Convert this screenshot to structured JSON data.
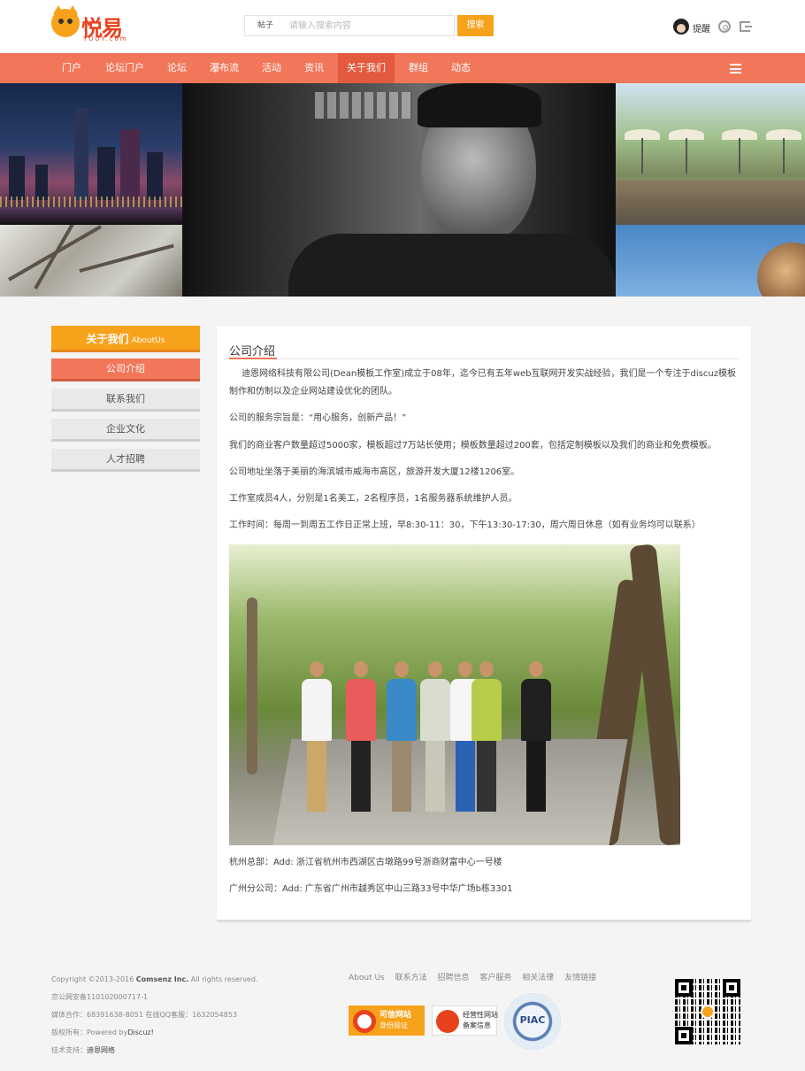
{
  "header": {
    "logo_text": "悦易",
    "logo_sub": "YUUY.com",
    "search_type": "帖子",
    "search_placeholder": "请输入搜索内容",
    "search_button": "搜索",
    "user_remind": "提醒"
  },
  "nav": {
    "items": [
      "门户",
      "论坛门户",
      "论坛",
      "瀑布流",
      "活动",
      "资讯",
      "关于我们",
      "群组",
      "动态"
    ],
    "active": "关于我们"
  },
  "sidebar": {
    "title": "关于我们",
    "title_en": "AboutUs",
    "items": [
      "公司介绍",
      "联系我们",
      "企业文化",
      "人才招聘"
    ],
    "active": "公司介绍"
  },
  "content": {
    "title": "公司介绍",
    "paragraphs": [
      "迪恩网络科技有限公司(Dean模板工作室)成立于08年，迄今已有五年web互联网开发实战经验，我们是一个专注于discuz模板制作和仿制以及企业网站建设优化的团队。",
      "公司的服务宗旨是：“用心服务，创新产品！”",
      "我们的商业客户数量超过5000家，模板超过7万站长使用；模板数量超过200套，包括定制模板以及我们的商业和免费模板。",
      "公司地址坐落于美丽的海滨城市威海市高区，旅游开发大厦12楼1206室。",
      "工作室成员4人，分别是1名美工，2名程序员，1名服务器系统维护人员。",
      "工作时间：每周一到周五工作日正常上班，早8:30-11：30，下午13:30-17:30，周六周日休息（如有业务均可以联系）"
    ],
    "addresses": [
      "杭州总部：Add: 浙江省杭州市西湖区古墩路99号浙商财富中心一号楼",
      "广州分公司：Add: 广东省广州市越秀区中山三路33号中华广场b栋3301"
    ]
  },
  "footer": {
    "copyright_prefix": "Copyright  ©2013-2016 ",
    "copyright_company": "Comsenz Inc.",
    "copyright_suffix": " All rights reserved.",
    "icp": "京公网安备110102000717-1",
    "contact": "媒体合作：68391638-8051    在线QQ客服：1632054853",
    "powered_prefix": "版权所有：Powered by",
    "powered_name": "Discuz!",
    "support_prefix": "技术支持：",
    "support_name": "迪恩网络",
    "links": [
      "About Us",
      "联系方法",
      "招聘信息",
      "客户服务",
      "相关法律",
      "友情链接"
    ],
    "badge1_line1": "可信网站",
    "badge1_line2": "身份验证",
    "badge2_line1": "经营性网站",
    "badge2_line2": "备案信息",
    "badge3": "PIAC"
  },
  "colors": {
    "nav": "#f2775a",
    "accent": "#f7a21b",
    "brand_red": "#e8411e"
  }
}
